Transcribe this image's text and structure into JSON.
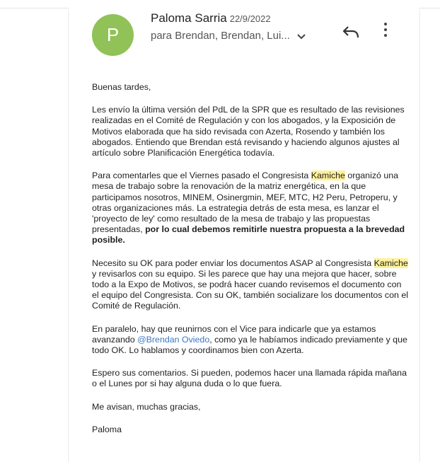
{
  "email": {
    "avatar_letter": "P",
    "avatar_color": "#90c257",
    "sender_name": "Paloma Sarria",
    "date": "22/9/2022",
    "recipients": "para Brendan, Brendan, Lui...",
    "greeting": "Buenas tardes,",
    "p1": "Les envío la última versión del PdL de la SPR que es resultado de las revisiones realizadas en el Comité de Regulación y con los abogados, y la Exposición de Motivos elaborada que ha sido revisada con Azerta, Rosendo y también los abogados. Entiendo que Brendan está revisando y haciendo algunos ajustes al artículo sobre Planificación Energética todavía.",
    "p2": {
      "before": "Para comentarles que el Viernes pasado el Congresista ",
      "highlight": "Kamiche",
      "after": " organizó una mesa de trabajo sobre la renovación de la matriz energética, en la que participamos nosotros, MINEM, Osinergmin, MEF, MTC, H2 Peru, Petroperu, y otras organizaciones más. La estrategia detrás de esta mesa, es lanzar el 'proyecto de ley' como resultado de la mesa de trabajo y las propuestas presentadas, ",
      "bold": "por lo cual debemos remitirle nuestra propuesta a la brevedad posible."
    },
    "p3": {
      "before": "Necesito su OK para poder enviar los documentos ASAP al Congresista ",
      "highlight": "Kamiche",
      "after": " y revisarlos con su equipo. Si les parece que hay una mejora que hacer, sobre todo a la Expo de Motivos, se podrá hacer cuando revisemos el documento con el equipo del Congresista. Con su OK, también socializare los documentos con el Comité de Regulación."
    },
    "p4": {
      "before": "En paralelo, hay que reunirnos con el Vice para indicarle que ya estamos avanzando ",
      "mention": "@Brendan Oviedo",
      "after": ", como ya le habíamos indicado previamente y que todo OK. Lo hablamos y coordinamos bien con Azerta."
    },
    "p5": "Espero sus comentarios. Si pueden, podemos hacer una llamada rápida mañana o el Lunes por si hay alguna duda o lo que fuera.",
    "p6": "Me avisan, muchas gracias,",
    "signature": "Paloma"
  },
  "icons": {
    "reply": "reply-icon",
    "more": "more-vert-icon",
    "expand": "chevron-down-icon"
  }
}
